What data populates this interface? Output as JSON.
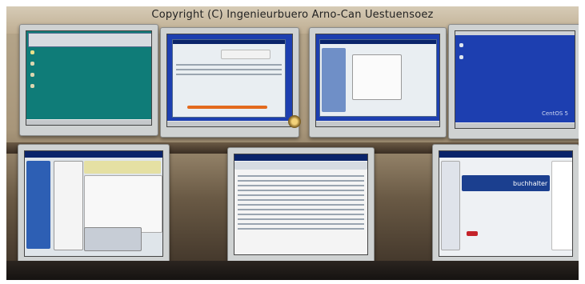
{
  "caption": "Copyright (C) Ingenieurbuero Arno-Can Uestuensoez",
  "screens": {
    "os_logo_text": "CentOS 5",
    "banner_text": "buchhalter"
  },
  "colors": {
    "desktop_teal": "#0f7c78",
    "desktop_blue": "#1d3fb0",
    "window_face": "#e9eef2",
    "monitor_bezel": "#cfd2d2"
  }
}
